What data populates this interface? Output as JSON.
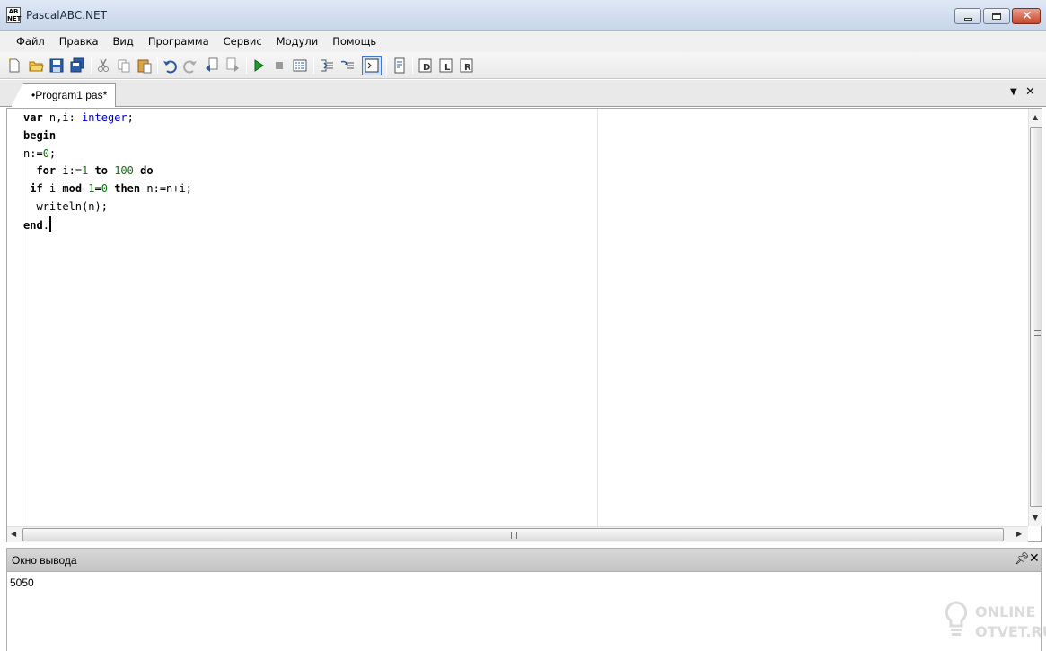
{
  "window": {
    "title": "PascalABC.NET",
    "icon_text": "AB NET"
  },
  "menu": [
    "Файл",
    "Правка",
    "Вид",
    "Программа",
    "Сервис",
    "Модули",
    "Помощь"
  ],
  "toolbar": {
    "icons": [
      "new-file-icon",
      "open-icon",
      "save-icon",
      "save-all-icon",
      "cut-icon",
      "copy-icon",
      "paste-icon",
      "undo-icon",
      "redo-icon",
      "find-icon",
      "replace-icon",
      "run-icon",
      "stop-icon",
      "compile-icon",
      "step-into-icon",
      "step-over-icon",
      "output-window-icon",
      "format-icon",
      "debug-d-icon",
      "debug-l-icon",
      "debug-r-icon"
    ]
  },
  "tabs": [
    {
      "label": "•Program1.pas*",
      "active": true
    }
  ],
  "editor": {
    "lines": [
      "var n,i: integer;",
      "begin",
      "n:=0;",
      "  for i:=1 to 100 do",
      " if i mod 1=0 then n:=n+i;",
      "  writeln(n);",
      "end."
    ]
  },
  "output": {
    "title": "Окно вывода",
    "text": "5050"
  },
  "watermark": {
    "line1": "ONLINE",
    "line2": "OTVET.RU"
  },
  "colors": {
    "keyword": "#000000",
    "type": "#0000c8",
    "number": "#0a7a0a"
  }
}
